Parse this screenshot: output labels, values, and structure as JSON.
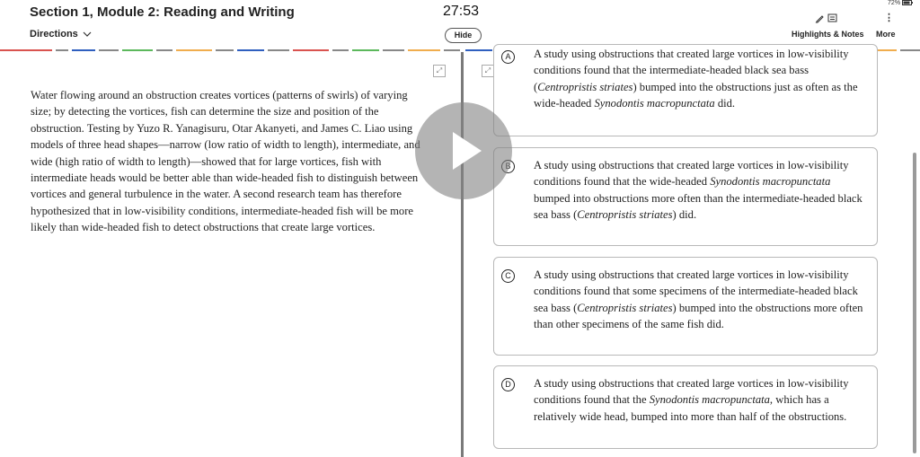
{
  "header": {
    "title": "Section 1, Module 2: Reading and Writing",
    "directions_label": "Directions",
    "timer": "27:53",
    "hide_label": "Hide",
    "battery": "72%",
    "highlights_label": "Highlights & Notes",
    "more_label": "More"
  },
  "passage": {
    "text": "Water flowing around an obstruction creates vortices (patterns of swirls) of varying size; by detecting the vortices, fish can determine the size and position of the obstruction. Testing by Yuzo R. Yanagisuru, Otar Akanyeti, and James C. Liao using models of three head shapes—narrow (low ratio of width to length), intermediate, and wide (high ratio of width to length)—showed that for large vortices, fish with intermediate heads would be better able than wide-headed fish to distinguish between vortices and general turbulence in the water. A second research team has therefore hypothesized that in low-visibility conditions, intermediate-headed fish will be more likely than wide-headed fish to detect obstructions that create large vortices."
  },
  "choices": [
    {
      "letter": "A",
      "parts": [
        "A study using obstructions that created large vortices in low-visibility conditions found that the intermediate-headed black sea bass (",
        "Centropristis striates",
        ") bumped into the obstructions just as often as the wide-headed ",
        "Synodontis macropunctata",
        " did."
      ]
    },
    {
      "letter": "B",
      "parts": [
        "A study using obstructions that created large vortices in low-visibility conditions found that the wide-headed ",
        "Synodontis macropunctata",
        " bumped into obstructions more often than the intermediate-headed black sea bass (",
        "Centropristis striates",
        ") did."
      ]
    },
    {
      "letter": "C",
      "parts": [
        "A study using obstructions that created large vortices in low-visibility conditions found that some specimens of the intermediate-headed black sea bass (",
        "Centropristis striates",
        ") bumped into the obstructions more often than other specimens of the same fish did."
      ]
    },
    {
      "letter": "D",
      "parts": [
        "A study using obstructions that created large vortices in low-visibility conditions found that the ",
        "Synodontis macropunctata",
        ", which has a relatively wide head, bumped into more than half of the obstructions."
      ]
    }
  ],
  "colors": {
    "dash_colors": [
      "#d9534f",
      "#2f5fbf",
      "#f0ad4e",
      "#5cb85c"
    ],
    "divider": "#7a7a7a"
  },
  "icons": [
    "chevron-down-icon",
    "pencil-icon",
    "notes-icon",
    "more-vertical-icon",
    "expand-icon",
    "play-icon"
  ]
}
